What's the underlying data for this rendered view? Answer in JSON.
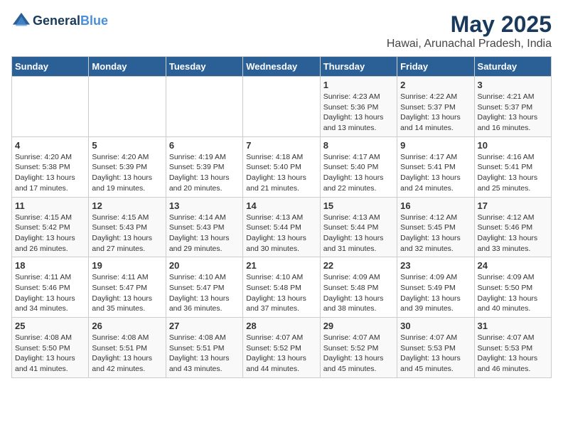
{
  "header": {
    "logo_line1": "General",
    "logo_line2": "Blue",
    "title": "May 2025",
    "subtitle": "Hawai, Arunachal Pradesh, India"
  },
  "weekdays": [
    "Sunday",
    "Monday",
    "Tuesday",
    "Wednesday",
    "Thursday",
    "Friday",
    "Saturday"
  ],
  "weeks": [
    [
      {
        "day": "",
        "info": ""
      },
      {
        "day": "",
        "info": ""
      },
      {
        "day": "",
        "info": ""
      },
      {
        "day": "",
        "info": ""
      },
      {
        "day": "1",
        "info": "Sunrise: 4:23 AM\nSunset: 5:36 PM\nDaylight: 13 hours\nand 13 minutes."
      },
      {
        "day": "2",
        "info": "Sunrise: 4:22 AM\nSunset: 5:37 PM\nDaylight: 13 hours\nand 14 minutes."
      },
      {
        "day": "3",
        "info": "Sunrise: 4:21 AM\nSunset: 5:37 PM\nDaylight: 13 hours\nand 16 minutes."
      }
    ],
    [
      {
        "day": "4",
        "info": "Sunrise: 4:20 AM\nSunset: 5:38 PM\nDaylight: 13 hours\nand 17 minutes."
      },
      {
        "day": "5",
        "info": "Sunrise: 4:20 AM\nSunset: 5:39 PM\nDaylight: 13 hours\nand 19 minutes."
      },
      {
        "day": "6",
        "info": "Sunrise: 4:19 AM\nSunset: 5:39 PM\nDaylight: 13 hours\nand 20 minutes."
      },
      {
        "day": "7",
        "info": "Sunrise: 4:18 AM\nSunset: 5:40 PM\nDaylight: 13 hours\nand 21 minutes."
      },
      {
        "day": "8",
        "info": "Sunrise: 4:17 AM\nSunset: 5:40 PM\nDaylight: 13 hours\nand 22 minutes."
      },
      {
        "day": "9",
        "info": "Sunrise: 4:17 AM\nSunset: 5:41 PM\nDaylight: 13 hours\nand 24 minutes."
      },
      {
        "day": "10",
        "info": "Sunrise: 4:16 AM\nSunset: 5:41 PM\nDaylight: 13 hours\nand 25 minutes."
      }
    ],
    [
      {
        "day": "11",
        "info": "Sunrise: 4:15 AM\nSunset: 5:42 PM\nDaylight: 13 hours\nand 26 minutes."
      },
      {
        "day": "12",
        "info": "Sunrise: 4:15 AM\nSunset: 5:43 PM\nDaylight: 13 hours\nand 27 minutes."
      },
      {
        "day": "13",
        "info": "Sunrise: 4:14 AM\nSunset: 5:43 PM\nDaylight: 13 hours\nand 29 minutes."
      },
      {
        "day": "14",
        "info": "Sunrise: 4:13 AM\nSunset: 5:44 PM\nDaylight: 13 hours\nand 30 minutes."
      },
      {
        "day": "15",
        "info": "Sunrise: 4:13 AM\nSunset: 5:44 PM\nDaylight: 13 hours\nand 31 minutes."
      },
      {
        "day": "16",
        "info": "Sunrise: 4:12 AM\nSunset: 5:45 PM\nDaylight: 13 hours\nand 32 minutes."
      },
      {
        "day": "17",
        "info": "Sunrise: 4:12 AM\nSunset: 5:46 PM\nDaylight: 13 hours\nand 33 minutes."
      }
    ],
    [
      {
        "day": "18",
        "info": "Sunrise: 4:11 AM\nSunset: 5:46 PM\nDaylight: 13 hours\nand 34 minutes."
      },
      {
        "day": "19",
        "info": "Sunrise: 4:11 AM\nSunset: 5:47 PM\nDaylight: 13 hours\nand 35 minutes."
      },
      {
        "day": "20",
        "info": "Sunrise: 4:10 AM\nSunset: 5:47 PM\nDaylight: 13 hours\nand 36 minutes."
      },
      {
        "day": "21",
        "info": "Sunrise: 4:10 AM\nSunset: 5:48 PM\nDaylight: 13 hours\nand 37 minutes."
      },
      {
        "day": "22",
        "info": "Sunrise: 4:09 AM\nSunset: 5:48 PM\nDaylight: 13 hours\nand 38 minutes."
      },
      {
        "day": "23",
        "info": "Sunrise: 4:09 AM\nSunset: 5:49 PM\nDaylight: 13 hours\nand 39 minutes."
      },
      {
        "day": "24",
        "info": "Sunrise: 4:09 AM\nSunset: 5:50 PM\nDaylight: 13 hours\nand 40 minutes."
      }
    ],
    [
      {
        "day": "25",
        "info": "Sunrise: 4:08 AM\nSunset: 5:50 PM\nDaylight: 13 hours\nand 41 minutes."
      },
      {
        "day": "26",
        "info": "Sunrise: 4:08 AM\nSunset: 5:51 PM\nDaylight: 13 hours\nand 42 minutes."
      },
      {
        "day": "27",
        "info": "Sunrise: 4:08 AM\nSunset: 5:51 PM\nDaylight: 13 hours\nand 43 minutes."
      },
      {
        "day": "28",
        "info": "Sunrise: 4:07 AM\nSunset: 5:52 PM\nDaylight: 13 hours\nand 44 minutes."
      },
      {
        "day": "29",
        "info": "Sunrise: 4:07 AM\nSunset: 5:52 PM\nDaylight: 13 hours\nand 45 minutes."
      },
      {
        "day": "30",
        "info": "Sunrise: 4:07 AM\nSunset: 5:53 PM\nDaylight: 13 hours\nand 45 minutes."
      },
      {
        "day": "31",
        "info": "Sunrise: 4:07 AM\nSunset: 5:53 PM\nDaylight: 13 hours\nand 46 minutes."
      }
    ]
  ]
}
